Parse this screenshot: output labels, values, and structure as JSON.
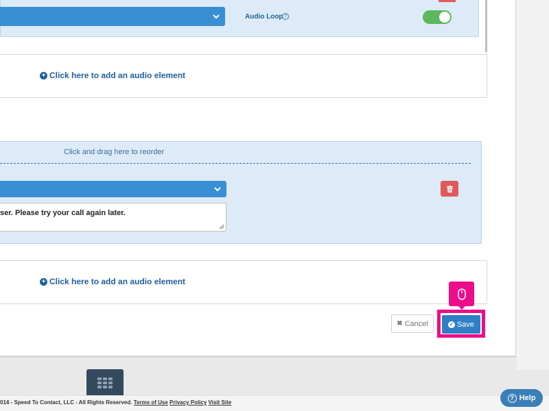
{
  "top_item": {
    "audio_loop_label": "Audio Loop",
    "audio_loop_help": "?",
    "toggle_on": true
  },
  "add_audio": {
    "label": "Click here to add an audio element"
  },
  "item_2": {
    "drag_label": "Click and drag here to reorder",
    "message_text": "ser.  Please try your call again later."
  },
  "actions": {
    "cancel_label": "Cancel",
    "save_label": "Save"
  },
  "footer": {
    "copyright": "014 - Speed To Contact, LLC - All Rights Reserved.",
    "terms_link": "Terms of Use",
    "privacy_link": "Privacy Policy",
    "visit_link": "Visit Site"
  },
  "help": {
    "label": "Help"
  },
  "colors": {
    "panel_blue": "#dcebf7",
    "select_blue": "#3a8fd4",
    "link_blue": "#1e5f9b",
    "danger": "#e05a5a",
    "toggle_green": "#5cb85c",
    "highlight": "#ec0d8b",
    "save_blue": "#2f7fc4",
    "dark_tab": "#34495e"
  },
  "icons": {
    "plus": "plus-circle-icon",
    "trash": "trash-icon",
    "chevron": "chevron-down-icon",
    "check": "check-circle-icon",
    "close": "x-icon",
    "mouse": "mouse-icon",
    "grid": "grid-icon",
    "help": "question-circle-icon"
  }
}
